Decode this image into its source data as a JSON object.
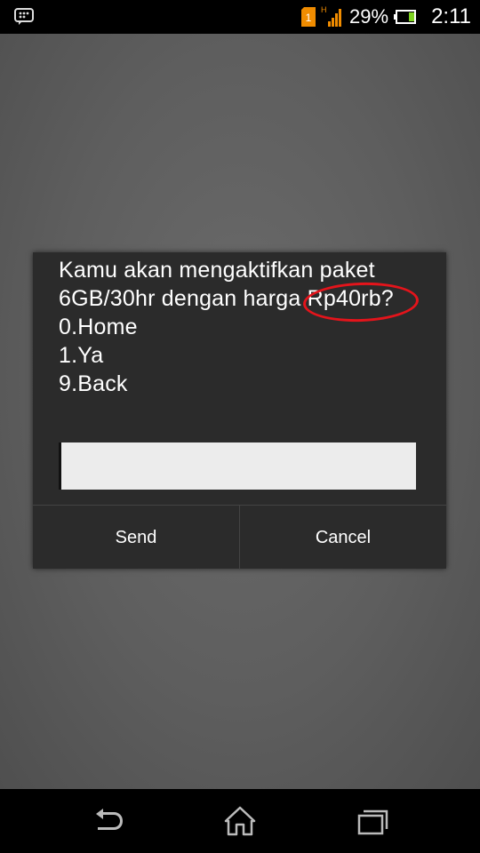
{
  "status_bar": {
    "notification_icon": "bbm-chat-icon",
    "sim_badge": "1",
    "network_type": "H",
    "battery_percent": "29%",
    "time": "2:11"
  },
  "dialog": {
    "lines": [
      "Kamu akan mengaktifkan paket",
      "6GB/30hr dengan harga ",
      "0.Home",
      "1.Ya",
      "9.Back"
    ],
    "price_text": "Rp40rb?",
    "input_value": "",
    "send_label": "Send",
    "cancel_label": "Cancel",
    "highlight_color": "#e4141b"
  },
  "nav_bar": {
    "buttons": [
      "back-icon",
      "home-icon",
      "recent-apps-icon"
    ]
  }
}
